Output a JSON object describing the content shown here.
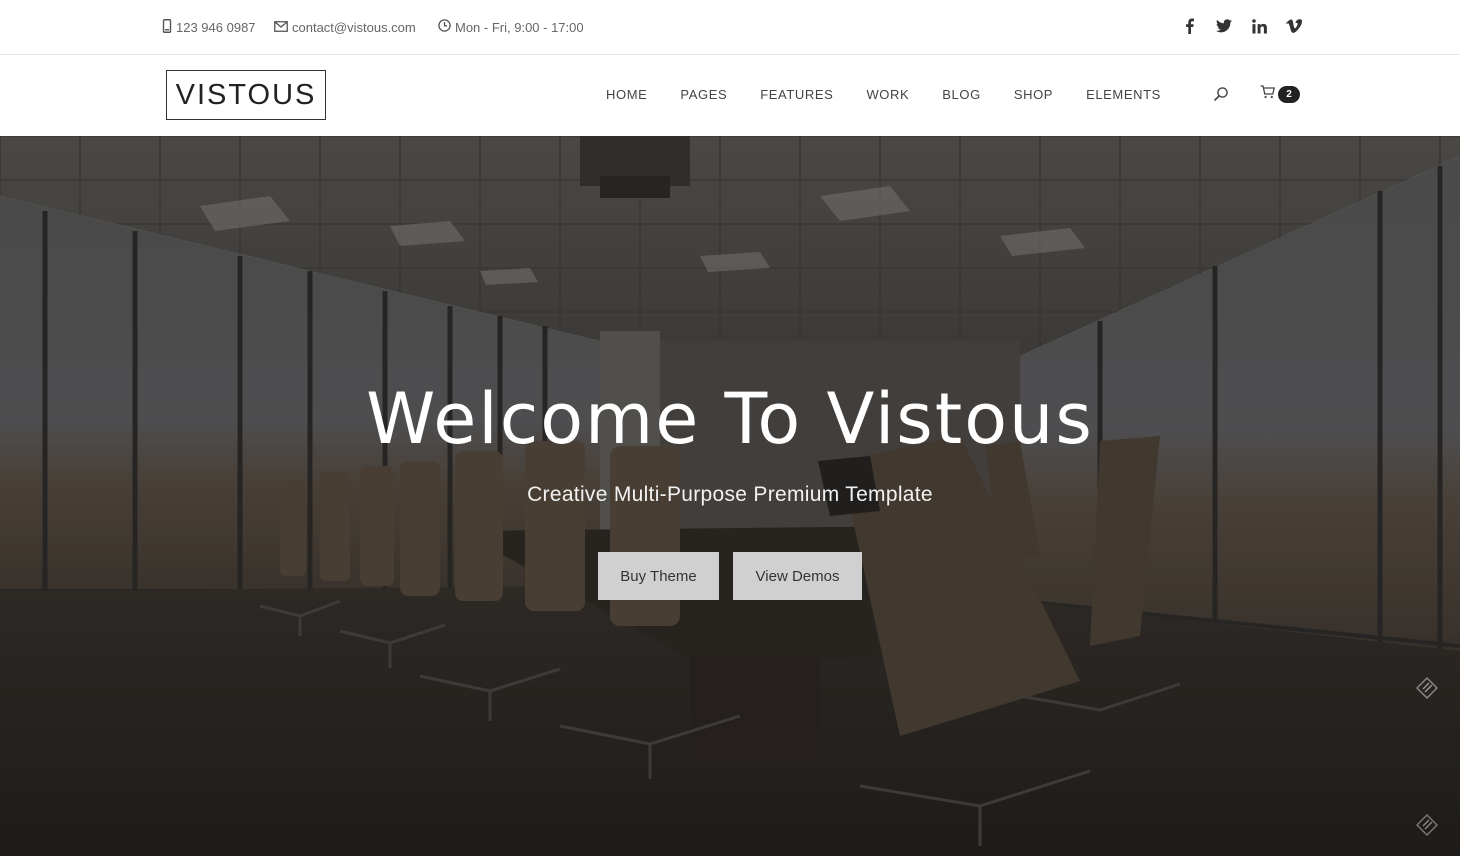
{
  "topbar": {
    "phone": "123 946 0987",
    "email": "contact@vistous.com",
    "hours": "Mon - Fri, 9:00 - 17:00",
    "social": [
      "facebook-icon",
      "twitter-icon",
      "linkedin-icon",
      "vimeo-icon"
    ]
  },
  "nav": {
    "logo": "VISTOUS",
    "items": [
      "HOME",
      "PAGES",
      "FEATURES",
      "WORK",
      "BLOG",
      "SHOP",
      "ELEMENTS"
    ],
    "cart_count": "2"
  },
  "hero": {
    "title": "Welcome To Vistous",
    "subtitle": "Creative Multi-Purpose Premium Template",
    "buttons": [
      "Buy Theme",
      "View Demos"
    ]
  },
  "colors": {
    "badge": "#222222",
    "button_bg": "#d0d0d0",
    "hero_overlay": "#1e1c1a"
  }
}
